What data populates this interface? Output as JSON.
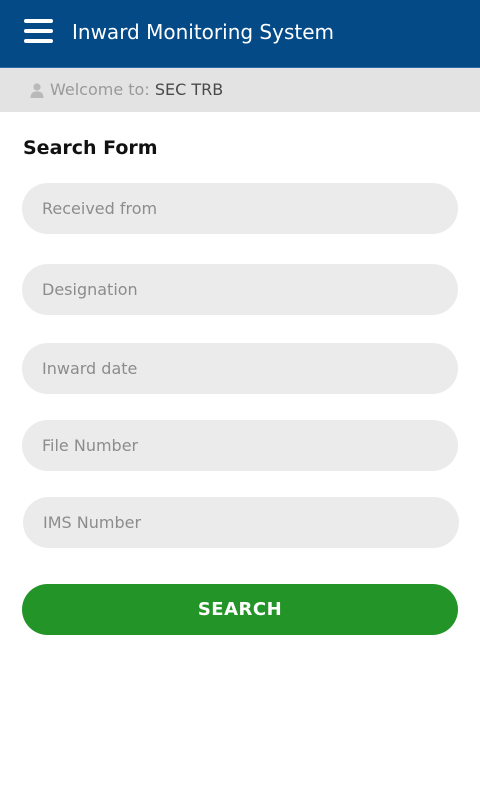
{
  "header": {
    "title": "Inward Monitoring System",
    "menu_icon": "hamburger-menu-icon",
    "background_color": "#034a87"
  },
  "welcome": {
    "prefix": "Welcome to:",
    "user": "SEC TRB",
    "icon": "user-icon"
  },
  "form": {
    "heading": "Search Form",
    "fields": {
      "received_from": {
        "placeholder": "Received from",
        "value": ""
      },
      "designation": {
        "placeholder": "Designation",
        "value": ""
      },
      "inward_date": {
        "placeholder": "Inward date",
        "value": ""
      },
      "file_number": {
        "placeholder": "File Number",
        "value": ""
      },
      "ims_number": {
        "placeholder": "IMS Number",
        "value": ""
      }
    },
    "submit_label": "SEARCH",
    "submit_color": "#239528"
  }
}
